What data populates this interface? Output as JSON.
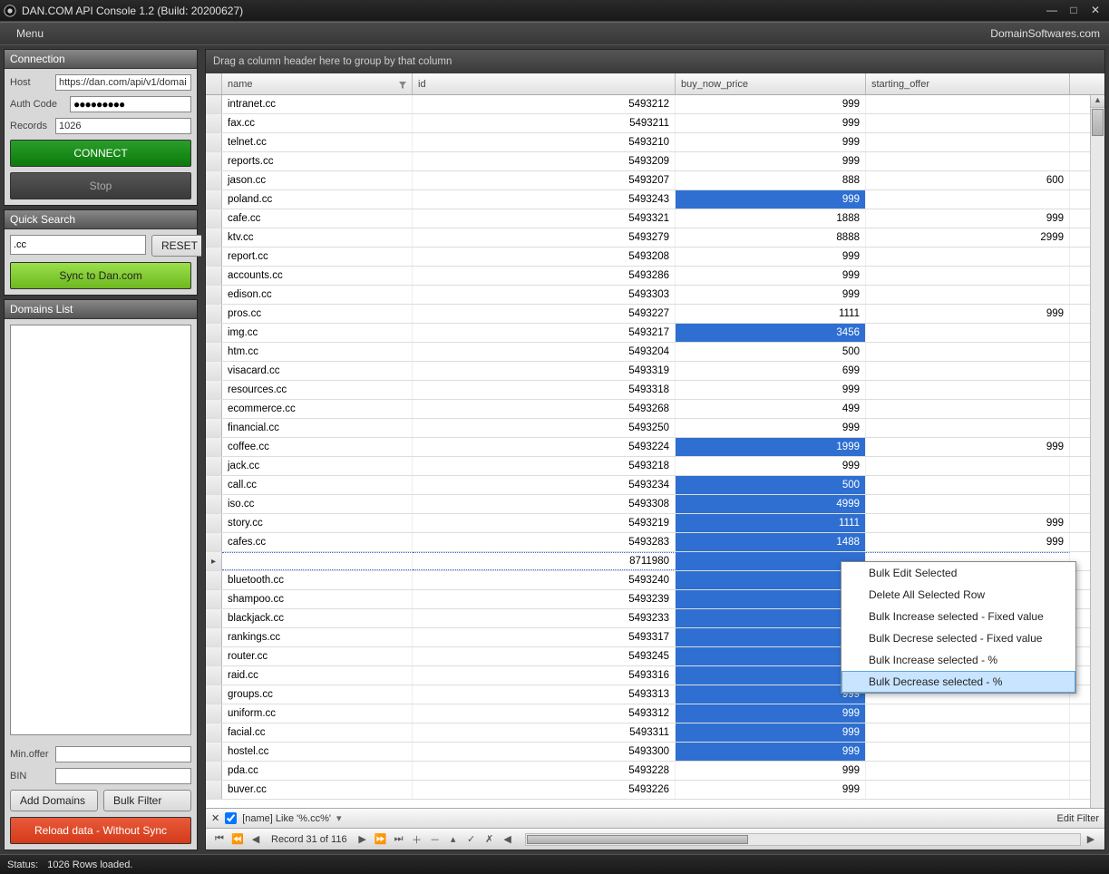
{
  "title": "DAN.COM API Console 1.2 (Build: 20200627)",
  "menu": {
    "label": "Menu"
  },
  "brand": "DomainSoftwares.com",
  "connection": {
    "header": "Connection",
    "host_label": "Host",
    "host_value": "https://dan.com/api/v1/domai",
    "auth_label": "Auth Code",
    "auth_masked": "●●●●●●●●●",
    "records_label": "Records",
    "records_value": "1026",
    "connect_btn": "CONNECT",
    "stop_btn": "Stop"
  },
  "quicksearch": {
    "header": "Quick Search",
    "value": ".cc",
    "reset_btn": "RESET",
    "sync_btn": "Sync to Dan.com"
  },
  "domainslist": {
    "header": "Domains List",
    "minoffer_label": "Min.offer",
    "minoffer_value": "",
    "bin_label": "BIN",
    "bin_value": "",
    "add_btn": "Add Domains",
    "bulkfilter_btn": "Bulk Filter",
    "reload_btn": "Reload data - Without Sync"
  },
  "grid": {
    "group_hint": "Drag a column header here to group by that column",
    "columns": {
      "name": "name",
      "id": "id",
      "price": "buy_now_price",
      "offer": "starting_offer"
    },
    "rows": [
      {
        "name": "intranet.cc",
        "id": "5493212",
        "price": "999",
        "offer": "",
        "sel": false,
        "cur": false
      },
      {
        "name": "fax.cc",
        "id": "5493211",
        "price": "999",
        "offer": "",
        "sel": false,
        "cur": false
      },
      {
        "name": "telnet.cc",
        "id": "5493210",
        "price": "999",
        "offer": "",
        "sel": false,
        "cur": false
      },
      {
        "name": "reports.cc",
        "id": "5493209",
        "price": "999",
        "offer": "",
        "sel": false,
        "cur": false
      },
      {
        "name": "jason.cc",
        "id": "5493207",
        "price": "888",
        "offer": "600",
        "sel": false,
        "cur": false
      },
      {
        "name": "poland.cc",
        "id": "5493243",
        "price": "999",
        "offer": "",
        "sel": true,
        "cur": false
      },
      {
        "name": "cafe.cc",
        "id": "5493321",
        "price": "1888",
        "offer": "999",
        "sel": false,
        "cur": false
      },
      {
        "name": "ktv.cc",
        "id": "5493279",
        "price": "8888",
        "offer": "2999",
        "sel": false,
        "cur": false
      },
      {
        "name": "report.cc",
        "id": "5493208",
        "price": "999",
        "offer": "",
        "sel": false,
        "cur": false
      },
      {
        "name": "accounts.cc",
        "id": "5493286",
        "price": "999",
        "offer": "",
        "sel": false,
        "cur": false
      },
      {
        "name": "edison.cc",
        "id": "5493303",
        "price": "999",
        "offer": "",
        "sel": false,
        "cur": false
      },
      {
        "name": "pros.cc",
        "id": "5493227",
        "price": "1111",
        "offer": "999",
        "sel": false,
        "cur": false
      },
      {
        "name": "img.cc",
        "id": "5493217",
        "price": "3456",
        "offer": "",
        "sel": true,
        "cur": false
      },
      {
        "name": "htm.cc",
        "id": "5493204",
        "price": "500",
        "offer": "",
        "sel": false,
        "cur": false
      },
      {
        "name": "visacard.cc",
        "id": "5493319",
        "price": "699",
        "offer": "",
        "sel": false,
        "cur": false
      },
      {
        "name": "resources.cc",
        "id": "5493318",
        "price": "999",
        "offer": "",
        "sel": false,
        "cur": false
      },
      {
        "name": "ecommerce.cc",
        "id": "5493268",
        "price": "499",
        "offer": "",
        "sel": false,
        "cur": false
      },
      {
        "name": "financial.cc",
        "id": "5493250",
        "price": "999",
        "offer": "",
        "sel": false,
        "cur": false
      },
      {
        "name": "coffee.cc",
        "id": "5493224",
        "price": "1999",
        "offer": "999",
        "sel": true,
        "cur": false
      },
      {
        "name": "jack.cc",
        "id": "5493218",
        "price": "999",
        "offer": "",
        "sel": false,
        "cur": false
      },
      {
        "name": "call.cc",
        "id": "5493234",
        "price": "500",
        "offer": "",
        "sel": true,
        "cur": false
      },
      {
        "name": "iso.cc",
        "id": "5493308",
        "price": "4999",
        "offer": "",
        "sel": true,
        "cur": false
      },
      {
        "name": "story.cc",
        "id": "5493219",
        "price": "1111",
        "offer": "999",
        "sel": true,
        "cur": false
      },
      {
        "name": "cafes.cc",
        "id": "5493283",
        "price": "1488",
        "offer": "999",
        "sel": true,
        "cur": false
      },
      {
        "name": "",
        "id": "8711980",
        "price": "",
        "offer": "",
        "sel": true,
        "cur": true
      },
      {
        "name": "bluetooth.cc",
        "id": "5493240",
        "price": "",
        "offer": "",
        "sel": true,
        "cur": false
      },
      {
        "name": "shampoo.cc",
        "id": "5493239",
        "price": "",
        "offer": "",
        "sel": true,
        "cur": false
      },
      {
        "name": "blackjack.cc",
        "id": "5493233",
        "price": "",
        "offer": "",
        "sel": true,
        "cur": false
      },
      {
        "name": "rankings.cc",
        "id": "5493317",
        "price": "",
        "offer": "",
        "sel": true,
        "cur": false
      },
      {
        "name": "router.cc",
        "id": "5493245",
        "price": "",
        "offer": "",
        "sel": true,
        "cur": false
      },
      {
        "name": "raid.cc",
        "id": "5493316",
        "price": "",
        "offer": "",
        "sel": true,
        "cur": false
      },
      {
        "name": "groups.cc",
        "id": "5493313",
        "price": "999",
        "offer": "",
        "sel": true,
        "cur": false
      },
      {
        "name": "uniform.cc",
        "id": "5493312",
        "price": "999",
        "offer": "",
        "sel": true,
        "cur": false
      },
      {
        "name": "facial.cc",
        "id": "5493311",
        "price": "999",
        "offer": "",
        "sel": true,
        "cur": false
      },
      {
        "name": "hostel.cc",
        "id": "5493300",
        "price": "999",
        "offer": "",
        "sel": true,
        "cur": false
      },
      {
        "name": "pda.cc",
        "id": "5493228",
        "price": "999",
        "offer": "",
        "sel": false,
        "cur": false
      },
      {
        "name": "buver.cc",
        "id": "5493226",
        "price": "999",
        "offer": "",
        "sel": false,
        "cur": false
      }
    ],
    "filter_text": "[name] Like '%.cc%'",
    "edit_filter": "Edit Filter",
    "record_text": "Record 31 of 116"
  },
  "context_menu": {
    "items": [
      "Bulk Edit Selected",
      "Delete All Selected Row",
      "Bulk Increase selected - Fixed value",
      "Bulk Decrese selected - Fixed value",
      "Bulk Increase selected - %",
      "Bulk Decrease selected - %"
    ],
    "hover_index": 5
  },
  "status": {
    "label": "Status:",
    "text": "1026 Rows loaded."
  }
}
